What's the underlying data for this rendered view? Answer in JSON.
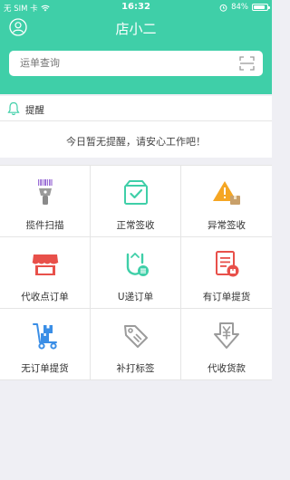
{
  "status_bar": {
    "carrier": "无 SIM 卡",
    "time": "16:32",
    "battery_text": "84%",
    "battery_level": 0.84
  },
  "header": {
    "title": "店小二",
    "left_icon": "user-avatar-icon",
    "bg_color": "#3fcfa8"
  },
  "search": {
    "placeholder": "运单查询",
    "right_icon": "scan-icon"
  },
  "reminder": {
    "title": "提醒",
    "icon": "bell-icon",
    "message": "今日暂无提醒，请安心工作吧！"
  },
  "grid": {
    "items": [
      {
        "label": "揽件扫描",
        "icon": "barcode-scanner-icon"
      },
      {
        "label": "正常签收",
        "icon": "box-check-icon"
      },
      {
        "label": "异常签收",
        "icon": "warning-box-icon"
      },
      {
        "label": "代收点订单",
        "icon": "store-icon"
      },
      {
        "label": "U递订单",
        "icon": "u-delivery-icon"
      },
      {
        "label": "有订单提货",
        "icon": "order-document-icon"
      },
      {
        "label": "无订单提货",
        "icon": "hand-truck-icon"
      },
      {
        "label": "补打标签",
        "icon": "tag-icon"
      },
      {
        "label": "代收货款",
        "icon": "yen-download-icon"
      }
    ]
  },
  "colors": {
    "accent": "#3fcfa8",
    "warning": "#f5a623",
    "danger": "#e8504a",
    "info": "#3a8ee6",
    "neutral": "#9b9b9b"
  }
}
